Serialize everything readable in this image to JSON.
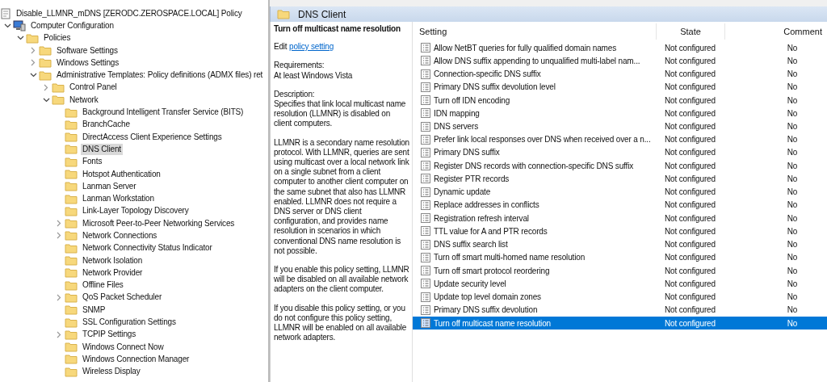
{
  "tree": [
    {
      "label": "Disable_LLMNR_mDNS [ZERODC.ZEROSPACE.LOCAL] Policy",
      "kind": "policy",
      "selected": false,
      "children": [
        {
          "label": "Computer Configuration",
          "kind": "computer",
          "selected": false,
          "expanded": true,
          "children": [
            {
              "label": "Policies",
              "kind": "folder",
              "selected": false,
              "expanded": true,
              "children": [
                {
                  "label": "Software Settings",
                  "kind": "folder",
                  "selected": false,
                  "expanded": false
                },
                {
                  "label": "Windows Settings",
                  "kind": "folder",
                  "selected": false,
                  "expanded": false
                },
                {
                  "label": "Administrative Templates: Policy definitions (ADMX files) ret",
                  "kind": "folder",
                  "selected": false,
                  "expanded": true,
                  "children": [
                    {
                      "label": "Control Panel",
                      "kind": "folder",
                      "selected": false,
                      "expanded": false
                    },
                    {
                      "label": "Network",
                      "kind": "folder",
                      "selected": false,
                      "expanded": true,
                      "children": [
                        {
                          "label": "Background Intelligent Transfer Service (BITS)",
                          "kind": "folder",
                          "selected": false
                        },
                        {
                          "label": "BranchCache",
                          "kind": "folder",
                          "selected": false
                        },
                        {
                          "label": "DirectAccess Client Experience Settings",
                          "kind": "folder",
                          "selected": false
                        },
                        {
                          "label": "DNS Client",
                          "kind": "folder",
                          "selected": true
                        },
                        {
                          "label": "Fonts",
                          "kind": "folder",
                          "selected": false
                        },
                        {
                          "label": "Hotspot Authentication",
                          "kind": "folder",
                          "selected": false
                        },
                        {
                          "label": "Lanman Server",
                          "kind": "folder",
                          "selected": false
                        },
                        {
                          "label": "Lanman Workstation",
                          "kind": "folder",
                          "selected": false
                        },
                        {
                          "label": "Link-Layer Topology Discovery",
                          "kind": "folder",
                          "selected": false
                        },
                        {
                          "label": "Microsoft Peer-to-Peer Networking Services",
                          "kind": "folder",
                          "selected": false,
                          "expanded": false
                        },
                        {
                          "label": "Network Connections",
                          "kind": "folder",
                          "selected": false,
                          "expanded": false
                        },
                        {
                          "label": "Network Connectivity Status Indicator",
                          "kind": "folder",
                          "selected": false
                        },
                        {
                          "label": "Network Isolation",
                          "kind": "folder",
                          "selected": false
                        },
                        {
                          "label": "Network Provider",
                          "kind": "folder",
                          "selected": false
                        },
                        {
                          "label": "Offline Files",
                          "kind": "folder",
                          "selected": false
                        },
                        {
                          "label": "QoS Packet Scheduler",
                          "kind": "folder",
                          "selected": false,
                          "expanded": false
                        },
                        {
                          "label": "SNMP",
                          "kind": "folder",
                          "selected": false
                        },
                        {
                          "label": "SSL Configuration Settings",
                          "kind": "folder",
                          "selected": false
                        },
                        {
                          "label": "TCPIP Settings",
                          "kind": "folder",
                          "selected": false,
                          "expanded": false
                        },
                        {
                          "label": "Windows Connect Now",
                          "kind": "folder",
                          "selected": false
                        },
                        {
                          "label": "Windows Connection Manager",
                          "kind": "folder",
                          "selected": false
                        },
                        {
                          "label": "Wireless Display",
                          "kind": "folder",
                          "selected": false
                        }
                      ]
                    }
                  ]
                }
              ]
            }
          ]
        }
      ]
    }
  ],
  "panel": {
    "title": "DNS Client"
  },
  "description": {
    "heading": "Turn off multicast name resolution",
    "edit_prefix": "Edit",
    "edit_link": "policy setting",
    "requirements_label": "Requirements:",
    "requirements": "At least Windows Vista",
    "description_label": "Description:",
    "paragraphs": [
      "Specifies that link local multicast name resolution (LLMNR) is disabled on client computers.",
      "LLMNR is a secondary name resolution protocol. With LLMNR, queries are sent using multicast over a local network link on a single subnet from a client computer to another client computer on the same subnet that also has LLMNR enabled. LLMNR does not require a DNS server or DNS client configuration, and provides name resolution in scenarios in which conventional DNS name resolution is not possible.",
      "If you enable this policy setting, LLMNR will be disabled on all available network adapters on the client computer.",
      "If you disable this policy setting, or you do not configure this policy setting, LLMNR will be enabled on all available network adapters."
    ]
  },
  "table": {
    "columns": [
      "Setting",
      "State",
      "Comment"
    ],
    "rows": [
      {
        "setting": "Allow NetBT queries for fully qualified domain names",
        "state": "Not configured",
        "comment": "No",
        "selected": false
      },
      {
        "setting": "Allow DNS suffix appending to unqualified multi-label nam...",
        "state": "Not configured",
        "comment": "No",
        "selected": false
      },
      {
        "setting": "Connection-specific DNS suffix",
        "state": "Not configured",
        "comment": "No",
        "selected": false
      },
      {
        "setting": "Primary DNS suffix devolution level",
        "state": "Not configured",
        "comment": "No",
        "selected": false
      },
      {
        "setting": "Turn off IDN encoding",
        "state": "Not configured",
        "comment": "No",
        "selected": false
      },
      {
        "setting": "IDN mapping",
        "state": "Not configured",
        "comment": "No",
        "selected": false
      },
      {
        "setting": "DNS servers",
        "state": "Not configured",
        "comment": "No",
        "selected": false
      },
      {
        "setting": "Prefer link local responses over DNS when received over a n...",
        "state": "Not configured",
        "comment": "No",
        "selected": false
      },
      {
        "setting": "Primary DNS suffix",
        "state": "Not configured",
        "comment": "No",
        "selected": false
      },
      {
        "setting": "Register DNS records with connection-specific DNS suffix",
        "state": "Not configured",
        "comment": "No",
        "selected": false
      },
      {
        "setting": "Register PTR records",
        "state": "Not configured",
        "comment": "No",
        "selected": false
      },
      {
        "setting": "Dynamic update",
        "state": "Not configured",
        "comment": "No",
        "selected": false
      },
      {
        "setting": "Replace addresses in conflicts",
        "state": "Not configured",
        "comment": "No",
        "selected": false
      },
      {
        "setting": "Registration refresh interval",
        "state": "Not configured",
        "comment": "No",
        "selected": false
      },
      {
        "setting": "TTL value for A and PTR records",
        "state": "Not configured",
        "comment": "No",
        "selected": false
      },
      {
        "setting": "DNS suffix search list",
        "state": "Not configured",
        "comment": "No",
        "selected": false
      },
      {
        "setting": "Turn off smart multi-homed name resolution",
        "state": "Not configured",
        "comment": "No",
        "selected": false
      },
      {
        "setting": "Turn off smart protocol reordering",
        "state": "Not configured",
        "comment": "No",
        "selected": false
      },
      {
        "setting": "Update security level",
        "state": "Not configured",
        "comment": "No",
        "selected": false
      },
      {
        "setting": "Update top level domain zones",
        "state": "Not configured",
        "comment": "No",
        "selected": false
      },
      {
        "setting": "Primary DNS suffix devolution",
        "state": "Not configured",
        "comment": "No",
        "selected": false
      },
      {
        "setting": "Turn off multicast name resolution",
        "state": "Not configured",
        "comment": "No",
        "selected": true
      }
    ]
  }
}
